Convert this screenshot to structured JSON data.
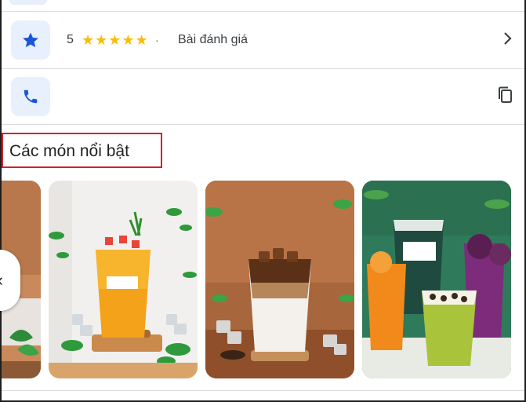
{
  "rating": {
    "value": "5",
    "stars": "★★★★★",
    "separator": "·",
    "reviews_label": "Bài đánh giá",
    "icon": "star-icon"
  },
  "phone": {
    "icon": "phone-icon",
    "copy_icon": "copy-icon"
  },
  "featured": {
    "title": "Các món nổi bật",
    "items": [
      {
        "name": "drink-card-1",
        "style": "partial"
      },
      {
        "name": "drink-card-2",
        "style": "orange-tea"
      },
      {
        "name": "drink-card-3",
        "style": "coffee-milk"
      },
      {
        "name": "drink-card-4",
        "style": "tea-collection"
      }
    ]
  },
  "colors": {
    "accent_blue": "#1a73e8",
    "tile_bg": "#e8f0fe",
    "star_yellow": "#fbbc04",
    "highlight_red": "#d3202c"
  }
}
